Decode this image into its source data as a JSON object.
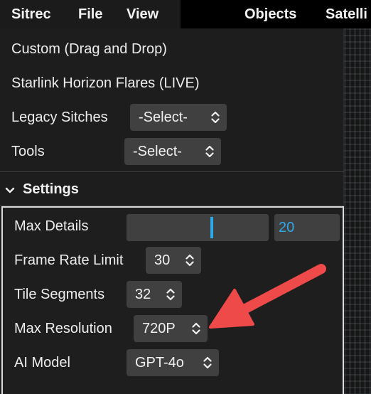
{
  "menubar": {
    "items": [
      {
        "label": "Sitrec"
      },
      {
        "label": "File"
      },
      {
        "label": "View"
      },
      {
        "label": "Objects"
      },
      {
        "label": "Satelli"
      }
    ]
  },
  "panel": {
    "items": [
      {
        "label": "Custom (Drag and Drop)"
      },
      {
        "label": "Starlink Horizon Flares (LIVE)"
      }
    ],
    "legacy_sitches": {
      "label": "Legacy Sitches",
      "value": "-Select-"
    },
    "tools": {
      "label": "Tools",
      "value": "-Select-"
    }
  },
  "settings": {
    "title": "Settings",
    "max_details": {
      "label": "Max Details",
      "value": "20",
      "fraction": 0.6
    },
    "frame_rate_limit": {
      "label": "Frame Rate Limit",
      "value": "30"
    },
    "tile_segments": {
      "label": "Tile Segments",
      "value": "32"
    },
    "max_resolution": {
      "label": "Max Resolution",
      "value": "720P"
    },
    "ai_model": {
      "label": "AI Model",
      "value": "GPT-4o"
    }
  },
  "colors": {
    "accent": "#2fa8e8",
    "annotation_arrow": "#ef4a4a"
  }
}
